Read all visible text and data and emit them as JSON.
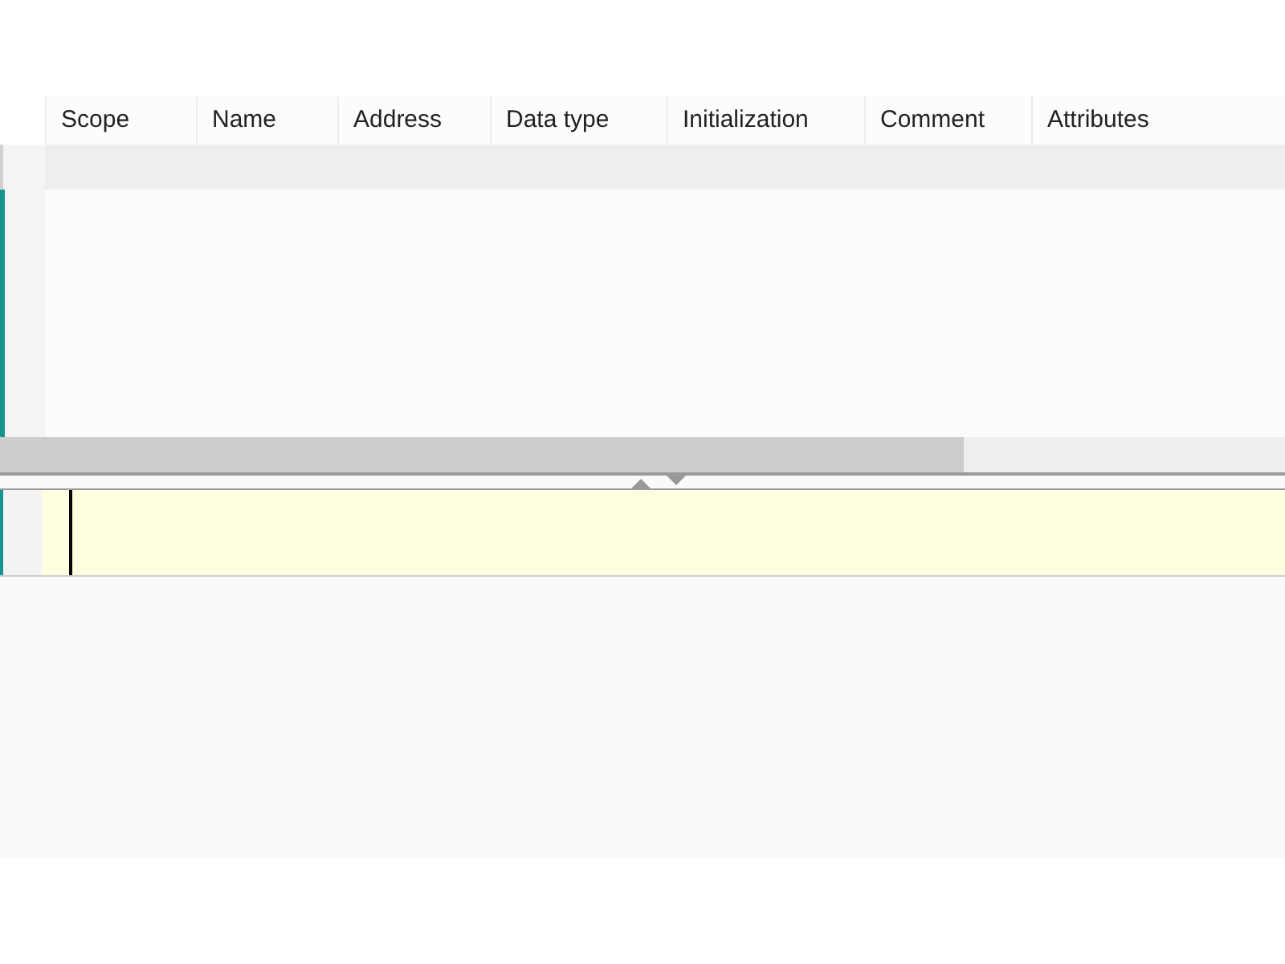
{
  "table": {
    "columns": [
      {
        "label": "Scope"
      },
      {
        "label": "Name"
      },
      {
        "label": "Address"
      },
      {
        "label": "Data type"
      },
      {
        "label": "Initialization"
      },
      {
        "label": "Comment"
      },
      {
        "label": "Attributes"
      }
    ]
  }
}
